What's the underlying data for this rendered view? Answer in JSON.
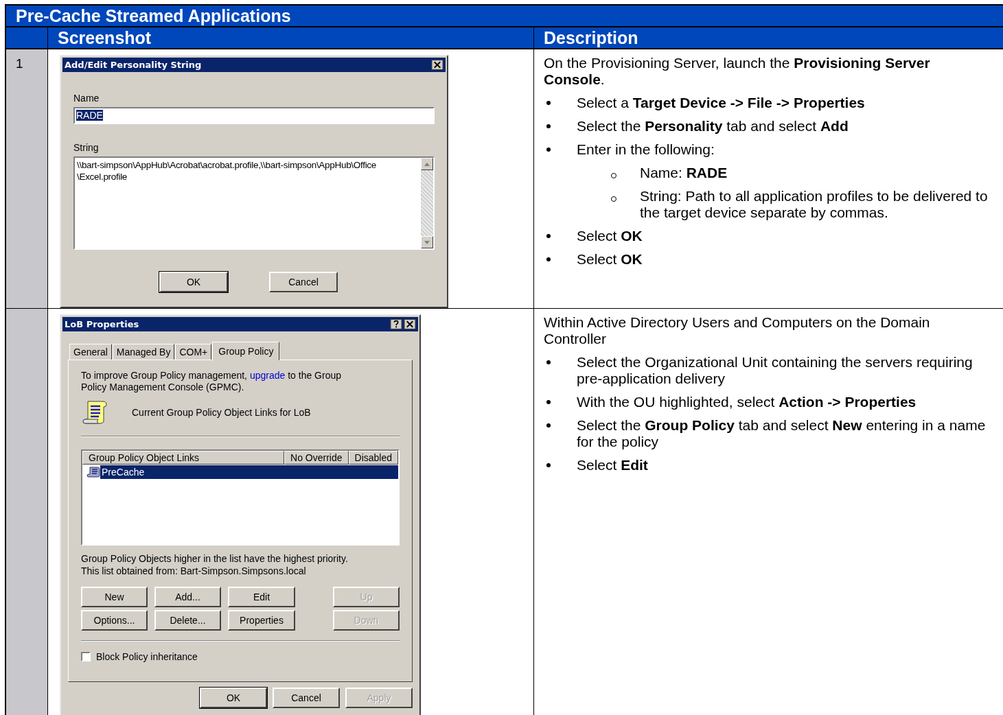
{
  "table": {
    "title": "Pre-Cache Streamed Applications",
    "columns": [
      "Screenshot",
      "Description"
    ],
    "rows": [
      {
        "number": "1",
        "dialog": {
          "kind": "string_editor",
          "title": "Add/Edit Personality String",
          "name_label": "Name",
          "name_value": "RADE",
          "name_selected": true,
          "string_label": "String",
          "string_lines": [
            "\\\\bart-simpson\\AppHub\\Acrobat\\acrobat.profile,\\\\bart-simpson\\AppHub\\Office",
            "\\Excel.profile"
          ],
          "buttons": [
            {
              "label": "OK",
              "default": true
            },
            {
              "label": "Cancel",
              "default": false
            }
          ]
        },
        "description": [
          {
            "kind": "para",
            "text": "On the Provisioning Server, launch the **Provisioning Server Console**."
          },
          {
            "kind": "bullet",
            "text": "Select a **Target Device -> File -> Properties**"
          },
          {
            "kind": "bullet",
            "text": "Select the **Personality** tab and select **Add**"
          },
          {
            "kind": "bullet",
            "text": "Enter in the following:"
          },
          {
            "kind": "sub",
            "text": "Name: **RADE**"
          },
          {
            "kind": "sub",
            "text": "String: Path to all application profiles to be delivered to the target device separate by commas."
          },
          {
            "kind": "bullet",
            "text": "Select **OK**"
          },
          {
            "kind": "bullet",
            "text": "Select **OK**"
          }
        ]
      },
      {
        "dialog": {
          "kind": "properties",
          "title": "LoB Properties",
          "tabs": [
            {
              "label": "General",
              "selected": false
            },
            {
              "label": "Managed By",
              "selected": false
            },
            {
              "label": "COM+",
              "selected": false
            },
            {
              "label": "Group Policy",
              "selected": true
            }
          ],
          "intro_before": "To improve Group Policy management,",
          "intro_link": "upgrade",
          "intro_after": "to the Group Policy Management Console (GPMC).",
          "links_heading": "Current Group Policy Object Links for LoB",
          "list_columns": [
            "Group Policy Object Links",
            "No Override",
            "Disabled"
          ],
          "list_rows": [
            {
              "name": "PreCache",
              "selected": true
            }
          ],
          "notes": [
            "Group Policy Objects higher in the list have the highest priority.",
            "This list obtained from: Bart-Simpson.Simpsons.local"
          ],
          "action_buttons": [
            {
              "label": "New",
              "disabled": false
            },
            {
              "label": "Add...",
              "disabled": false
            },
            {
              "label": "Edit",
              "disabled": false
            },
            {
              "label": "Up",
              "disabled": true
            },
            {
              "label": "Options...",
              "disabled": false
            },
            {
              "label": "Delete...",
              "disabled": false
            },
            {
              "label": "Properties",
              "disabled": false
            },
            {
              "label": "Down",
              "disabled": true
            }
          ],
          "checkbox": {
            "label": "Block Policy inheritance",
            "checked": false
          },
          "buttons": [
            {
              "label": "OK",
              "disabled": false
            },
            {
              "label": "Cancel",
              "disabled": false
            },
            {
              "label": "Apply",
              "disabled": true
            }
          ]
        },
        "description": [
          {
            "kind": "para",
            "text": "Within Active Directory Users and Computers on the Domain Controller"
          },
          {
            "kind": "bullet",
            "text": "Select the Organizational Unit containing the servers requiring pre-application delivery"
          },
          {
            "kind": "bullet",
            "text": "With the OU highlighted, select **Action -> Properties**"
          },
          {
            "kind": "bullet",
            "text": "Select the **Group Policy** tab and select **New** entering in a name for the policy"
          },
          {
            "kind": "bullet",
            "text": "Select **Edit**"
          }
        ]
      }
    ]
  }
}
